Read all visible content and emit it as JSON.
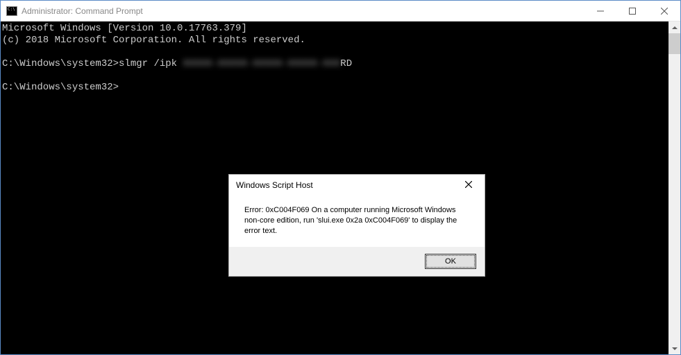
{
  "window": {
    "title": "Administrator: Command Prompt"
  },
  "console": {
    "line1": "Microsoft Windows [Version 10.0.17763.379]",
    "line2": "(c) 2018 Microsoft Corporation. All rights reserved.",
    "prompt1_prefix": "C:\\Windows\\system32>",
    "cmd1": "slmgr /ipk ",
    "cmd1_blurred": "XXXXX-XXXXX-XXXXX-XXXXX-XXX",
    "cmd1_suffix": "RD",
    "prompt2": "C:\\Windows\\system32>"
  },
  "dialog": {
    "title": "Windows Script Host",
    "message": "Error: 0xC004F069 On a computer running Microsoft Windows non-core edition, run 'slui.exe 0x2a 0xC004F069' to display the error text.",
    "ok_label": "OK"
  }
}
